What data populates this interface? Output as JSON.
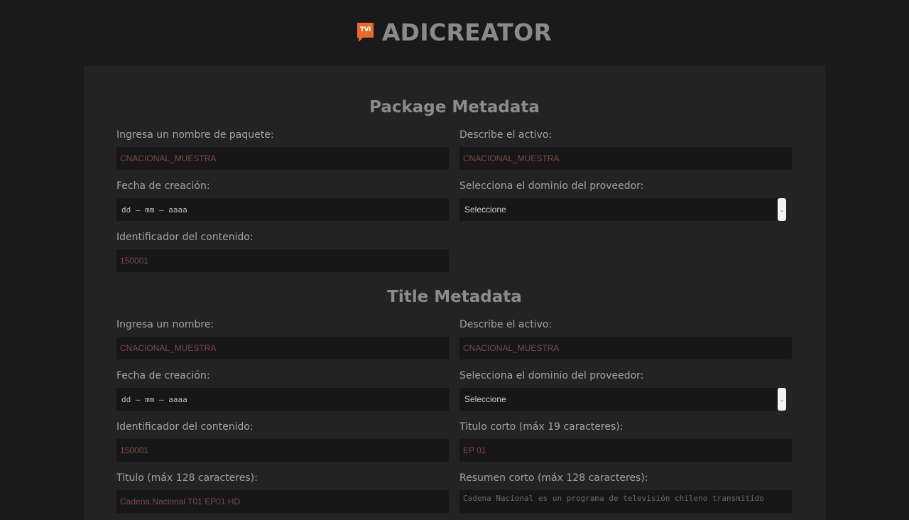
{
  "header": {
    "logo_text": "TVI",
    "title": "ADICREATOR"
  },
  "package": {
    "title": "Package Metadata",
    "name_label": "Ingresa un nombre de paquete:",
    "name_value": "CNACIONAL_MUESTRA",
    "desc_label": "Describe el activo:",
    "desc_value": "CNACIONAL_MUESTRA",
    "date_label": "Fecha de creación:",
    "date_value": "dd – mm – aaaa",
    "domain_label": "Selecciona el dominio del proveedor:",
    "domain_value": "Seleccione",
    "id_label": "Identificador del contenido:",
    "id_value": "150001"
  },
  "title_meta": {
    "title": "Title Metadata",
    "name_label": "Ingresa un nombre:",
    "name_value": "CNACIONAL_MUESTRA",
    "desc_label": "Describe el activo:",
    "desc_value": "CNACIONAL_MUESTRA",
    "date_label": "Fecha de creación:",
    "date_value": "dd – mm – aaaa",
    "domain_label": "Selecciona el dominio del proveedor:",
    "domain_value": "Seleccione",
    "id_label": "Identificador del contenido:",
    "id_value": "150001",
    "short_title_label": "Titulo corto (máx 19 caracteres):",
    "short_title_value": "EP 01",
    "long_title_label": "Titulo (máx 128 caracteres):",
    "long_title_value": "Cadena Nacional T01 EP01 HD",
    "summary_label": "Resumen corto (máx 128 caracteres):",
    "summary_value": "Cadena Nacional es un programa de televisión chileno transmitido"
  }
}
